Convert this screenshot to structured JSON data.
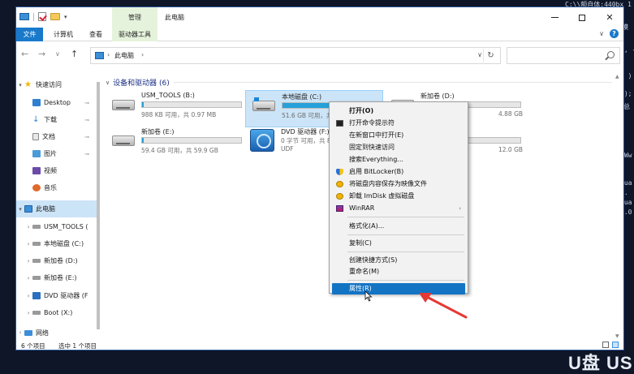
{
  "background": {
    "terminal_lines": [
      "C:\\\\额自体:440bx 1 ",
      "模",
      "', -SC",
      "' )",
      "i);",
      "总",
      "N",
      "/Ww",
      "tua",
      "0.",
      "tua",
      "0.0"
    ],
    "logo": "U盘 US"
  },
  "window": {
    "title": "此电脑",
    "context_tab_header": "管理",
    "minimize_label": "—",
    "maximize_label": "",
    "close_label": "✕"
  },
  "ribbon": {
    "tabs": [
      "文件",
      "计算机",
      "查看",
      "驱动器工具"
    ],
    "expand_label": "∨",
    "help_label": "?"
  },
  "navbar": {
    "back": "←",
    "forward": "→",
    "recent": "∨",
    "up": "↑",
    "breadcrumb": "此电脑",
    "search_placeholder": ""
  },
  "sidebar": {
    "items": [
      {
        "label": "快速访问",
        "kind": "star"
      },
      {
        "label": "Desktop",
        "pinned": true
      },
      {
        "label": "下载",
        "pinned": true
      },
      {
        "label": "文档",
        "pinned": true
      },
      {
        "label": "图片",
        "pinned": true
      },
      {
        "label": "视频"
      },
      {
        "label": "音乐"
      },
      {
        "label": "此电脑"
      },
      {
        "label": "USM_TOOLS ("
      },
      {
        "label": "本地磁盘 (C:)"
      },
      {
        "label": "新加卷 (D:)"
      },
      {
        "label": "新加卷 (E:)"
      },
      {
        "label": "DVD 驱动器 (F"
      },
      {
        "label": "Boot (X:)"
      },
      {
        "label": "网络"
      }
    ],
    "pin_glyph": "📌"
  },
  "main": {
    "group_header": "设备和驱动器 (6)",
    "drives": [
      {
        "name": "USM_TOOLS (B:)",
        "sub": "988 KB 可用，共 0.97 MB",
        "used_fraction": 0.02
      },
      {
        "name": "本地磁盘 (C:)",
        "sub": "51.6 GB 可用，共",
        "used_fraction": 0.55
      },
      {
        "name": "新加卷 (D:)",
        "sub": "4.88 GB",
        "used_fraction": 0.03
      },
      {
        "name": "新加卷 (E:)",
        "sub": "59.4 GB 可用，共 59.9 GB",
        "used_fraction": 0.02
      },
      {
        "name": "DVD 驱动器 (F:) U",
        "sub": "0 字节 可用，共 8",
        "sub2": "UDF"
      },
      {
        "name": "",
        "sub": "12.0 GB",
        "used_fraction": 0.02
      }
    ]
  },
  "status": {
    "items_count": "6 个项目",
    "selected": "选中 1 个项目"
  },
  "context_menu": {
    "items": [
      {
        "label": "打开(O)",
        "bold": true
      },
      {
        "label": "打开命令提示符",
        "icon": "cmd"
      },
      {
        "label": "在新窗口中打开(E)"
      },
      {
        "label": "固定到快速访问"
      },
      {
        "label": "搜索Everything..."
      },
      {
        "label": "启用 BitLocker(B)",
        "icon": "shield"
      },
      {
        "label": "将磁盘内容保存为映像文件",
        "icon": "imd"
      },
      {
        "label": "卸载 ImDisk 虚拟磁盘",
        "icon": "imd"
      },
      {
        "label": "WinRAR",
        "icon": "rar",
        "submenu": true
      },
      {
        "label": "格式化(A)..."
      },
      {
        "label": "复制(C)"
      },
      {
        "label": "创建快捷方式(S)"
      },
      {
        "label": "重命名(M)"
      },
      {
        "label": "属性(R)",
        "highlighted": true
      }
    ],
    "submenu_arrow": "›"
  },
  "colors": {
    "accent": "#1979ca",
    "selection": "#cce4f7",
    "menu_highlight": "#1474c4",
    "annotation_arrow": "#e53935"
  }
}
